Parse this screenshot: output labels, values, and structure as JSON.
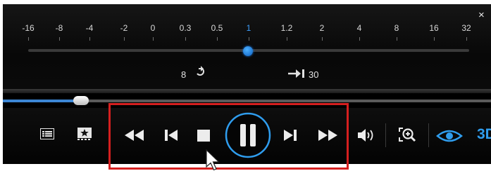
{
  "window": {
    "close_label": "×"
  },
  "speed": {
    "ticks": [
      "-16",
      "-8",
      "-4",
      "-2",
      "0",
      "0.3",
      "0.5",
      "1",
      "1.2",
      "2",
      "4",
      "8",
      "16",
      "32"
    ],
    "current": "1"
  },
  "repeat": {
    "count": "8",
    "icon": "loop-icon"
  },
  "skip": {
    "icon": "skip-forward-icon",
    "seconds": "30"
  },
  "playback": {
    "progress_fraction": 0.16
  },
  "controls": {
    "left": [
      "playlist-icon",
      "chapter-icon"
    ],
    "transport": [
      "rewind-icon",
      "previous-icon",
      "stop-icon",
      "pause-icon",
      "next-icon",
      "fast-forward-icon"
    ],
    "right": [
      "volume-icon",
      "zoom-icon",
      "eye-icon"
    ],
    "badge_3d": "3D"
  },
  "colors": {
    "accent": "#3ea0ff",
    "highlight": "#d51f1f",
    "background": "#000000"
  }
}
